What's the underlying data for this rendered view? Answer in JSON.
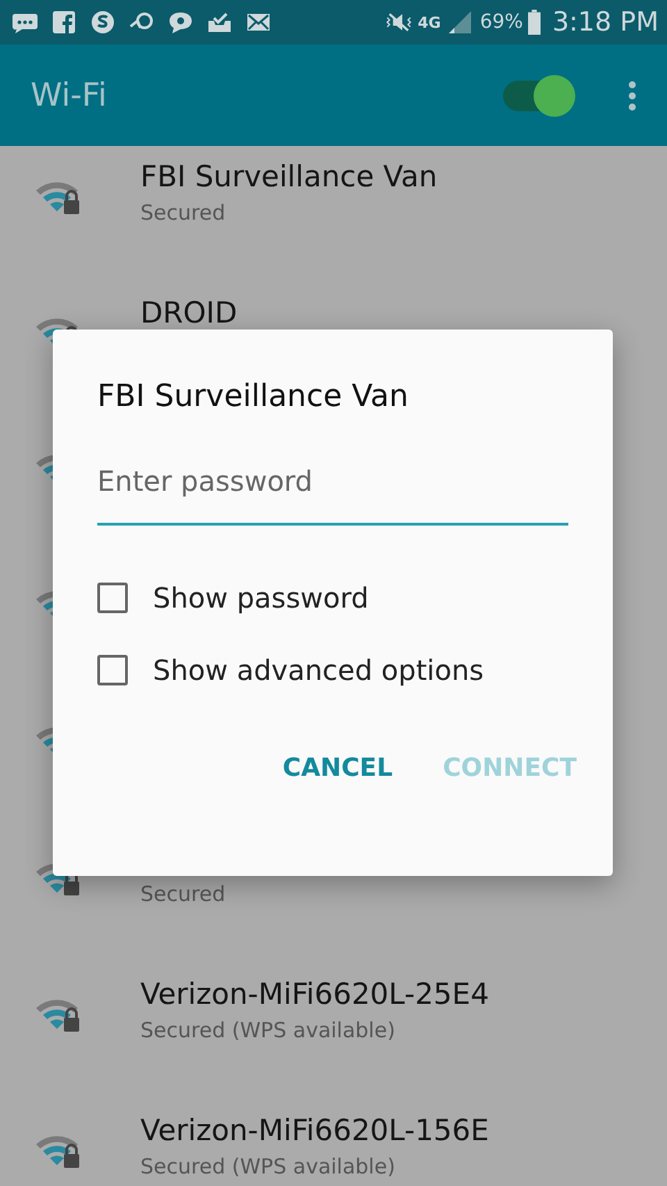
{
  "status_bar": {
    "network": "4G",
    "battery": "69%",
    "time": "3:18 PM"
  },
  "app_bar": {
    "title": "Wi-Fi",
    "wifi_on": true
  },
  "networks": [
    {
      "kind": "secured",
      "name": "FBI Surveillance Van",
      "status": "Secured"
    },
    {
      "kind": "secured",
      "name": "DROID"
    },
    {
      "kind": "secured"
    },
    {
      "kind": "secured"
    },
    {
      "kind": "secured"
    },
    {
      "kind": "secured",
      "status": "Secured"
    },
    {
      "kind": "secured",
      "name": "Verizon-MiFi6620L-25E4",
      "status": "Secured (WPS available)"
    },
    {
      "kind": "secured",
      "name": "Verizon-MiFi6620L-156E",
      "status": "Secured (WPS available)"
    }
  ],
  "dialog": {
    "title": "FBI Surveillance Van",
    "password": {
      "placeholder": "Enter password"
    },
    "options": [
      {
        "label": "Show password",
        "checked": false
      },
      {
        "label": "Show advanced options",
        "checked": false
      }
    ],
    "buttons": [
      {
        "label": "CANCEL",
        "disabled": false
      },
      {
        "label": "CONNECT",
        "disabled": true
      }
    ]
  }
}
